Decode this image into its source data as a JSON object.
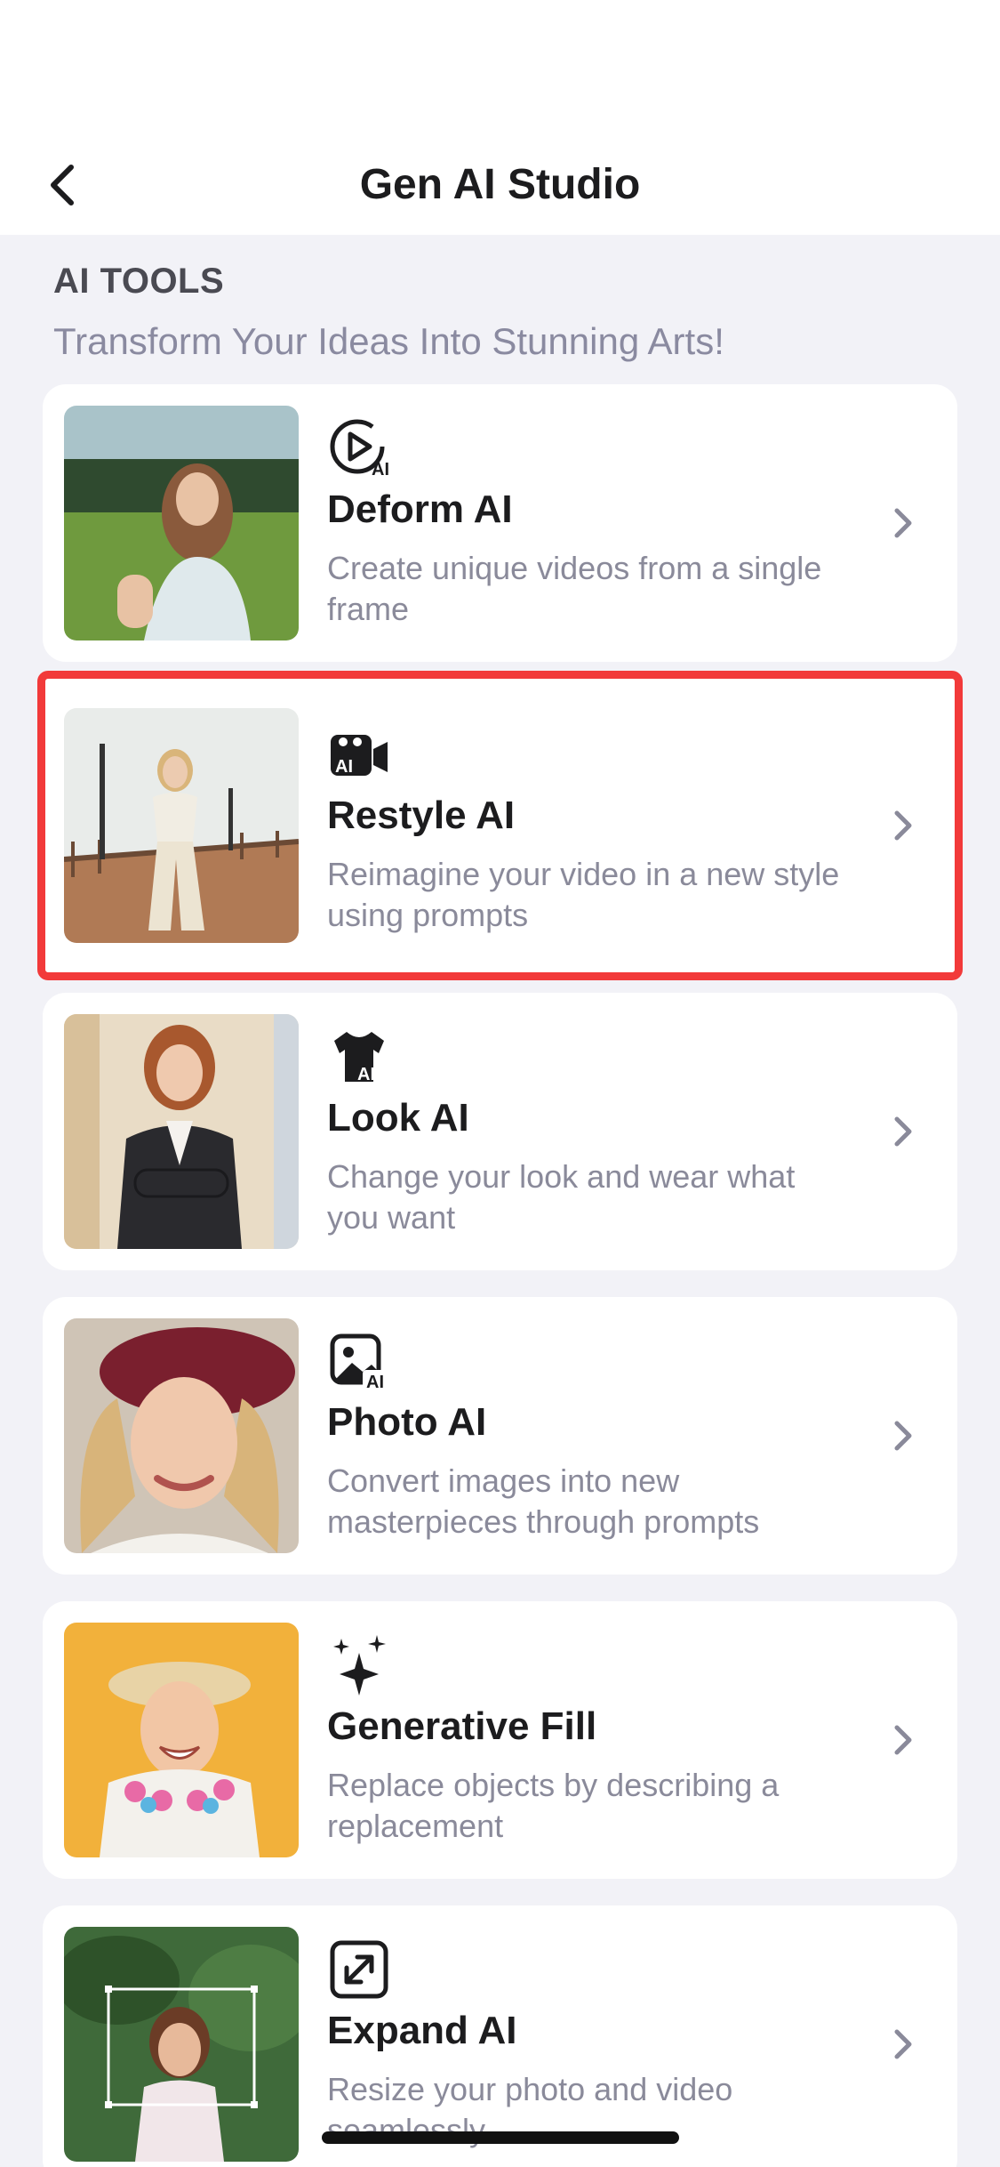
{
  "header": {
    "title": "Gen AI Studio"
  },
  "section": {
    "title": "AI TOOLS",
    "subtitle": "Transform Your Ideas Into Stunning Arts!"
  },
  "tools": [
    {
      "name": "Deform AI",
      "description": "Create unique videos from a single frame",
      "icon": "play-ai-icon"
    },
    {
      "name": "Restyle AI",
      "description": "Reimagine your video in a new style using prompts",
      "icon": "camera-ai-icon",
      "highlighted": true
    },
    {
      "name": "Look AI",
      "description": "Change your look and wear what you want",
      "icon": "shirt-ai-icon"
    },
    {
      "name": "Photo AI",
      "description": "Convert images into new masterpieces through prompts",
      "icon": "photo-ai-icon"
    },
    {
      "name": "Generative Fill",
      "description": "Replace objects by describing a replacement",
      "icon": "sparkles-icon"
    },
    {
      "name": "Expand AI",
      "description": "Resize your photo and video seamlessly",
      "icon": "expand-icon"
    }
  ],
  "colors": {
    "highlight": "#f23a3a",
    "background": "#f2f2f7",
    "card": "#ffffff"
  }
}
